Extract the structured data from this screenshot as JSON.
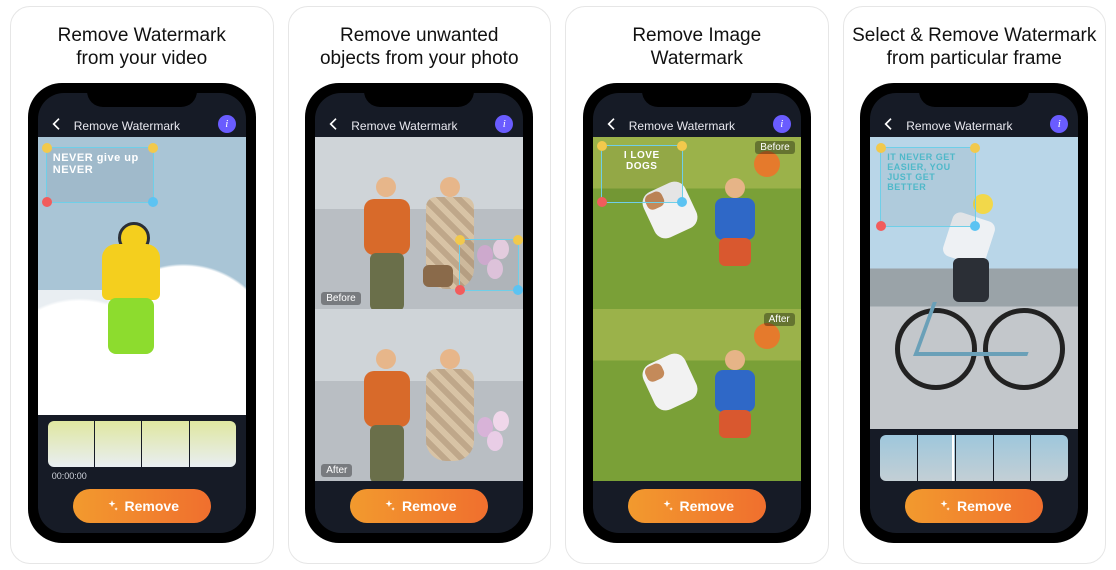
{
  "captions": [
    {
      "line1": "Remove Watermark",
      "line2": "from your video"
    },
    {
      "line1": "Remove unwanted",
      "line2": "objects from your photo"
    },
    {
      "line1": "Remove Image",
      "line2": "Watermark"
    },
    {
      "line1": "Select & Remove Watermark",
      "line2": "from particular frame"
    }
  ],
  "app": {
    "screen_title": "Remove Watermark",
    "remove_button": "Remove",
    "info_glyph": "i",
    "before_label": "Before",
    "after_label": "After",
    "timecode": "00:00:00"
  },
  "watermarks": {
    "video": "NEVER give up NEVER",
    "image": "I LOVE DOGS",
    "frame": "IT NEVER GET EASIER, YOU JUST GET BETTER"
  },
  "colors": {
    "screen_bg": "#161b26",
    "button_grad_start": "#f29a2e",
    "button_grad_end": "#f06f2e",
    "info_bg": "#6a5cff",
    "selection_border": "#6fcfe8"
  }
}
